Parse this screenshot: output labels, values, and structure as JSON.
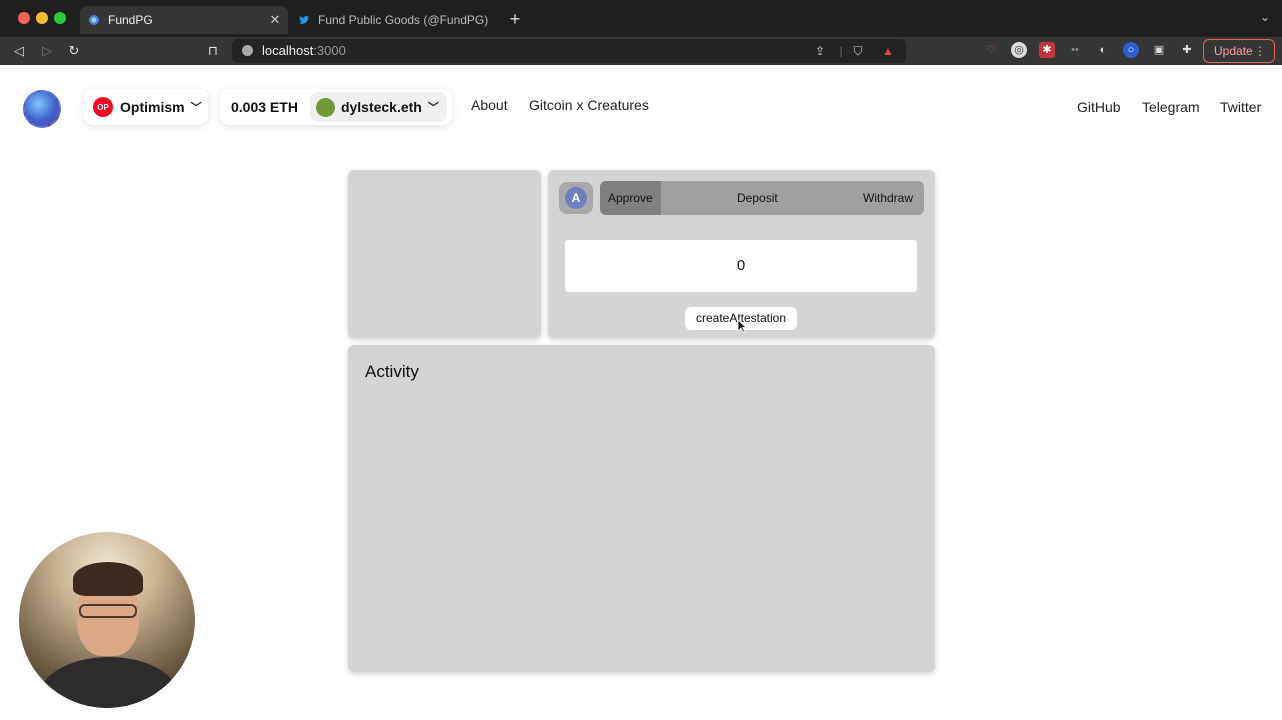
{
  "browser": {
    "tabs": [
      {
        "title": "FundPG",
        "active": true,
        "favicon": "fundpg-favicon"
      },
      {
        "title": "Fund Public Goods (@FundPG) / Tw",
        "active": false,
        "favicon": "twitter-bird-icon"
      }
    ],
    "new_tab_symbol": "+",
    "url_host": "localhost",
    "url_port": ":3000",
    "update_label": "Update",
    "colors": {
      "tabbar": "#1f1f1f",
      "toolbar": "#353535",
      "update_accent": "#e2655a"
    }
  },
  "header": {
    "network": {
      "badge": "OP",
      "name": "Optimism"
    },
    "account": {
      "balance": "0.003 ETH",
      "ens": "dylsteck.eth"
    },
    "nav": [
      {
        "label": "About"
      },
      {
        "label": "Gitcoin x Creatures"
      }
    ],
    "social": [
      {
        "label": "GitHub"
      },
      {
        "label": "Telegram"
      },
      {
        "label": "Twitter"
      }
    ]
  },
  "panel": {
    "badge_letter": "A",
    "tabs": [
      {
        "label": "Approve",
        "active": true
      },
      {
        "label": "Deposit",
        "active": false
      },
      {
        "label": "Withdraw",
        "active": false
      }
    ],
    "amount_value": "0",
    "action_label": "createAttestation"
  },
  "activity": {
    "title": "Activity"
  },
  "colors": {
    "card_bg": "#d4d4d4",
    "segment_bg": "#a0a0a0",
    "segment_active": "#808080",
    "optimism_red": "#ff0420"
  }
}
